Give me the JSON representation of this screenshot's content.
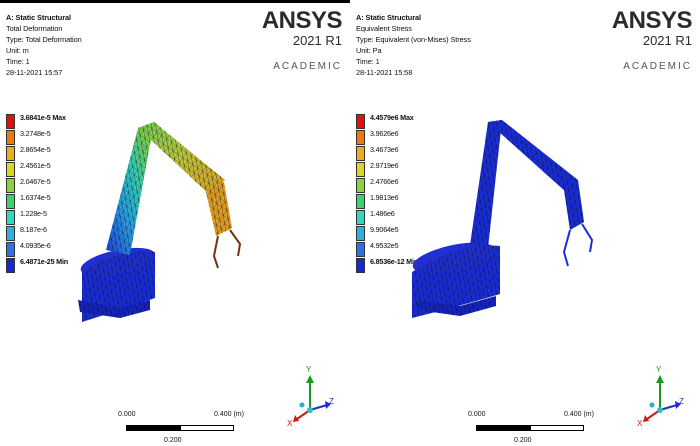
{
  "panels": [
    {
      "title": "A: Static Structural",
      "result": "Total Deformation",
      "type_line": "Type: Total Deformation",
      "unit": "Unit: m",
      "time": "Time: 1",
      "date": "28-11-2021 15:57",
      "legend": [
        {
          "label": "3.6841e-5 Max",
          "color": "#e01010",
          "bold": true
        },
        {
          "label": "3.2748e-5",
          "color": "#e87a10"
        },
        {
          "label": "2.8654e-5",
          "color": "#e8b020"
        },
        {
          "label": "2.4561e-5",
          "color": "#dcd820"
        },
        {
          "label": "2.0467e-5",
          "color": "#90d040"
        },
        {
          "label": "1.6374e-5",
          "color": "#40d070"
        },
        {
          "label": "1.228e-5",
          "color": "#30d8c0"
        },
        {
          "label": "8.187e-6",
          "color": "#30b0e0"
        },
        {
          "label": "4.0935e-6",
          "color": "#3070e0"
        },
        {
          "label": "6.4871e-25 Min",
          "color": "#1828d0",
          "bold": true
        }
      ],
      "scale": {
        "left": "0.000",
        "right": "0.400 (m)",
        "mid": "0.200"
      },
      "triad": {
        "x": "X",
        "y": "Y",
        "z": "Z"
      }
    },
    {
      "title": "A: Static Structural",
      "result": "Equivalent Stress",
      "type_line": "Type: Equivalent (von-Mises) Stress",
      "unit": "Unit: Pa",
      "time": "Time: 1",
      "date": "28-11-2021 15:58",
      "legend": [
        {
          "label": "4.4579e6 Max",
          "color": "#e01010",
          "bold": true
        },
        {
          "label": "3.9626e6",
          "color": "#e87a10"
        },
        {
          "label": "3.4673e6",
          "color": "#e8b020"
        },
        {
          "label": "2.9719e6",
          "color": "#dcd820"
        },
        {
          "label": "2.4766e6",
          "color": "#90d040"
        },
        {
          "label": "1.9813e6",
          "color": "#40d070"
        },
        {
          "label": "1.486e6",
          "color": "#30d8c0"
        },
        {
          "label": "9.9064e5",
          "color": "#30b0e0"
        },
        {
          "label": "4.9532e5",
          "color": "#3070e0"
        },
        {
          "label": "6.8536e-12 Min",
          "color": "#1828d0",
          "bold": true
        }
      ],
      "scale": {
        "left": "0.000",
        "right": "0.400 (m)",
        "mid": "0.200"
      },
      "triad": {
        "x": "X",
        "y": "Y",
        "z": "Z"
      }
    }
  ],
  "brand": {
    "name": "ANSYS",
    "version": "2021 R1",
    "edition": "ACADEMIC"
  },
  "colors": {
    "mesh_blue": "#1a2ed8",
    "mesh_line": "#0a0a40",
    "accent_black": "#000000"
  }
}
